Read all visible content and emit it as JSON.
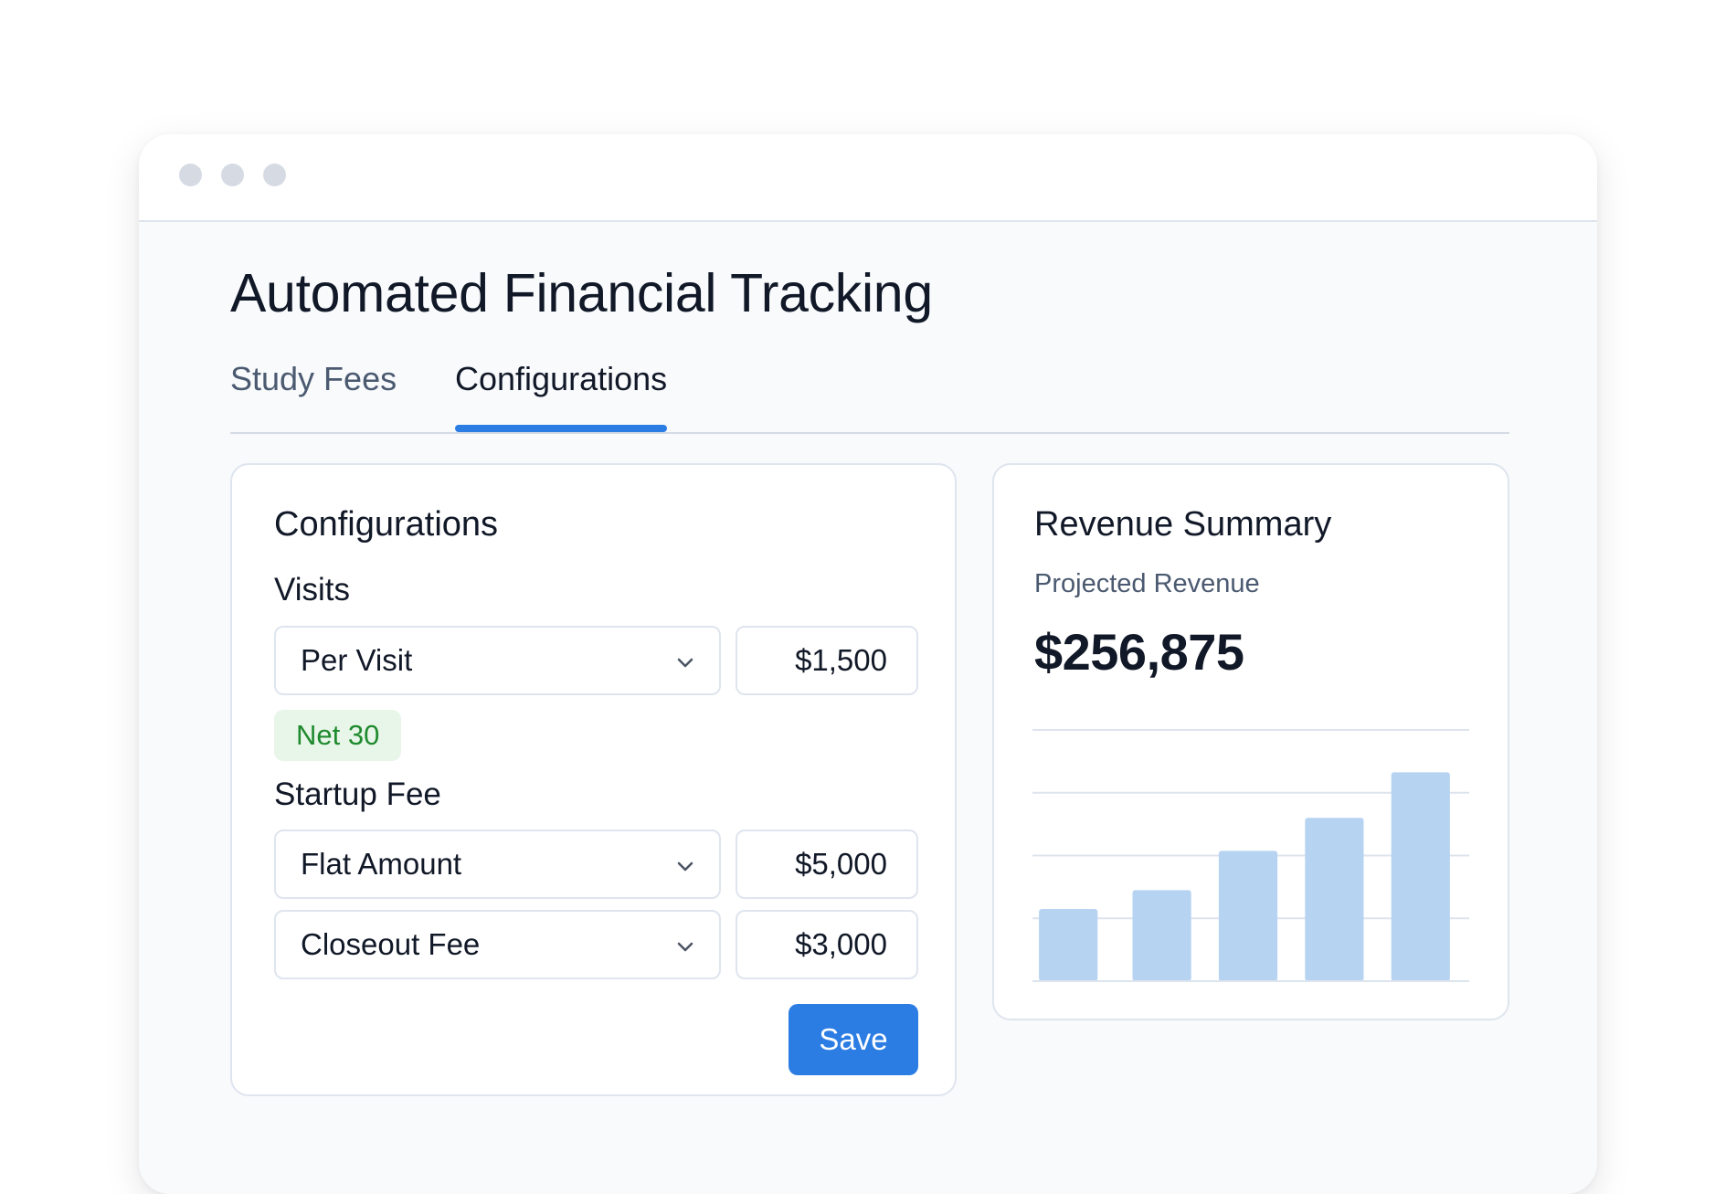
{
  "page": {
    "title": "Automated Financial Tracking"
  },
  "tabs": [
    {
      "label": "Study Fees",
      "active": false
    },
    {
      "label": "Configurations",
      "active": true
    }
  ],
  "configurations": {
    "heading": "Configurations",
    "visits": {
      "label": "Visits",
      "fee_type": "Per Visit",
      "amount": "$1,500",
      "payment_terms_badge": "Net 30"
    },
    "startup_fee": {
      "label": "Startup Fee",
      "rows": [
        {
          "fee_type": "Flat Amount",
          "amount": "$5,000"
        },
        {
          "fee_type": "Closeout Fee",
          "amount": "$3,000"
        }
      ]
    },
    "save_label": "Save"
  },
  "revenue_summary": {
    "heading": "Revenue Summary",
    "subtitle": "Projected Revenue",
    "value": "$256,875"
  },
  "chart_data": {
    "type": "bar",
    "title": "",
    "xlabel": "",
    "ylabel": "",
    "categories": [
      "",
      "",
      "",
      "",
      ""
    ],
    "values": [
      2.3,
      2.9,
      4.15,
      5.2,
      6.65
    ],
    "ylim": [
      0,
      8
    ],
    "gridlines": [
      2,
      4,
      6,
      8
    ],
    "grid": true,
    "legend": "none",
    "bar_color": "#b7d3f2",
    "grid_color": "#dde4ee"
  },
  "colors": {
    "accent": "#2b7de4",
    "badge_bg": "#e8f6e9",
    "badge_text": "#1f8a2e",
    "window_bg": "#f8fafc",
    "border": "#dfe5ee"
  },
  "icons": {
    "window_controls": [
      "window-dot-icon",
      "window-dot-icon",
      "window-dot-icon"
    ],
    "dropdown": "chevron-down-icon"
  }
}
